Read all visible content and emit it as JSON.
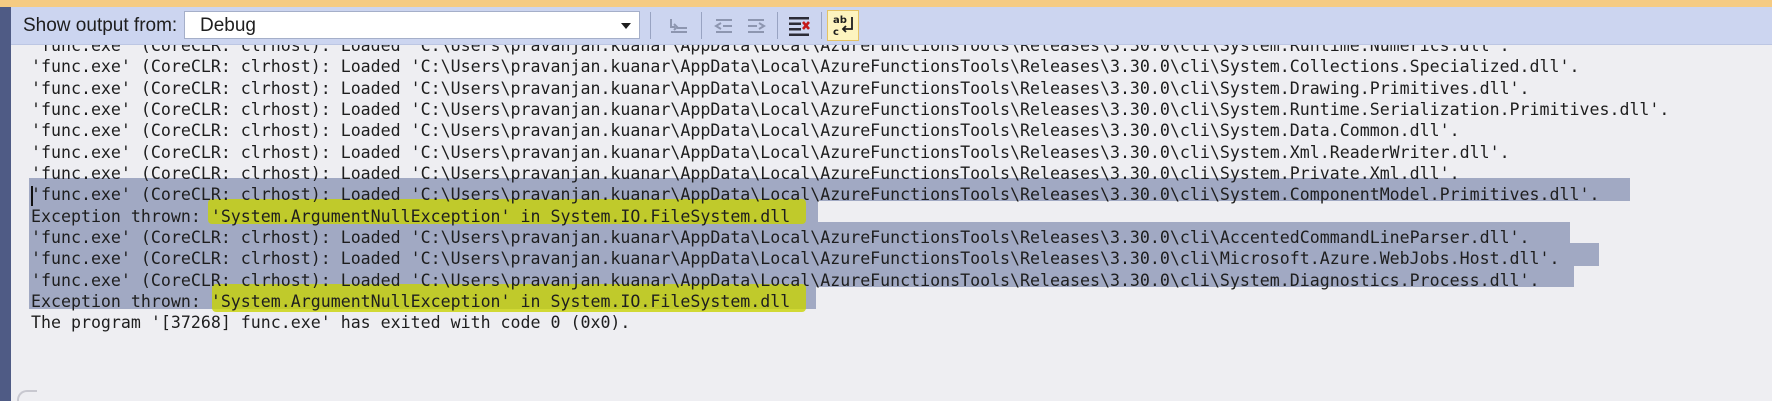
{
  "toolbar": {
    "label": "Show output from:",
    "selected_source": "Debug",
    "buttons": [
      {
        "name": "go-to-previous-message-button",
        "icon": "prev-message-icon",
        "enabled": false
      },
      {
        "name": "find-previous-button",
        "icon": "find-previous-icon",
        "enabled": false
      },
      {
        "name": "find-next-button",
        "icon": "find-next-icon",
        "enabled": false
      },
      {
        "name": "clear-all-button",
        "icon": "clear-all-icon",
        "enabled": true
      },
      {
        "name": "toggle-word-wrap-button",
        "icon": "word-wrap-icon",
        "enabled": true,
        "active": true
      }
    ]
  },
  "output": {
    "lines": [
      "'func.exe' (CoreCLR: clrhost): Loaded 'C:\\Users\\pravanjan.kuanar\\AppData\\Local\\AzureFunctionsTools\\Releases\\3.30.0\\cli\\System.Runtime.Numerics.dll'.",
      "'func.exe' (CoreCLR: clrhost): Loaded 'C:\\Users\\pravanjan.kuanar\\AppData\\Local\\AzureFunctionsTools\\Releases\\3.30.0\\cli\\System.Collections.Specialized.dll'.",
      "'func.exe' (CoreCLR: clrhost): Loaded 'C:\\Users\\pravanjan.kuanar\\AppData\\Local\\AzureFunctionsTools\\Releases\\3.30.0\\cli\\System.Drawing.Primitives.dll'.",
      "'func.exe' (CoreCLR: clrhost): Loaded 'C:\\Users\\pravanjan.kuanar\\AppData\\Local\\AzureFunctionsTools\\Releases\\3.30.0\\cli\\System.Runtime.Serialization.Primitives.dll'.",
      "'func.exe' (CoreCLR: clrhost): Loaded 'C:\\Users\\pravanjan.kuanar\\AppData\\Local\\AzureFunctionsTools\\Releases\\3.30.0\\cli\\System.Data.Common.dll'.",
      "'func.exe' (CoreCLR: clrhost): Loaded 'C:\\Users\\pravanjan.kuanar\\AppData\\Local\\AzureFunctionsTools\\Releases\\3.30.0\\cli\\System.Xml.ReaderWriter.dll'.",
      "'func.exe' (CoreCLR: clrhost): Loaded 'C:\\Users\\pravanjan.kuanar\\AppData\\Local\\AzureFunctionsTools\\Releases\\3.30.0\\cli\\System.Private.Xml.dll'.",
      "'func.exe' (CoreCLR: clrhost): Loaded 'C:\\Users\\pravanjan.kuanar\\AppData\\Local\\AzureFunctionsTools\\Releases\\3.30.0\\cli\\System.ComponentModel.Primitives.dll'.",
      "Exception thrown: 'System.ArgumentNullException' in System.IO.FileSystem.dll",
      "'func.exe' (CoreCLR: clrhost): Loaded 'C:\\Users\\pravanjan.kuanar\\AppData\\Local\\AzureFunctionsTools\\Releases\\3.30.0\\cli\\AccentedCommandLineParser.dll'.",
      "'func.exe' (CoreCLR: clrhost): Loaded 'C:\\Users\\pravanjan.kuanar\\AppData\\Local\\AzureFunctionsTools\\Releases\\3.30.0\\cli\\Microsoft.Azure.WebJobs.Host.dll'.",
      "'func.exe' (CoreCLR: clrhost): Loaded 'C:\\Users\\pravanjan.kuanar\\AppData\\Local\\AzureFunctionsTools\\Releases\\3.30.0\\cli\\System.Diagnostics.Process.dll'.",
      "Exception thrown: 'System.ArgumentNullException' in System.IO.FileSystem.dll",
      "The program '[37268] func.exe' has exited with code 0 (0x0)."
    ],
    "selected_line_range": [
      7,
      12
    ],
    "highlighted_line_indices": [
      8,
      12
    ]
  },
  "colors": {
    "accent_bar": "#f5cb83",
    "toolbar_bg": "#ccd5f0",
    "output_bg": "#eeeef2",
    "selection": "#a1a9c3",
    "marker_highlight": "#c9d400",
    "text": "#1e1e1e"
  }
}
